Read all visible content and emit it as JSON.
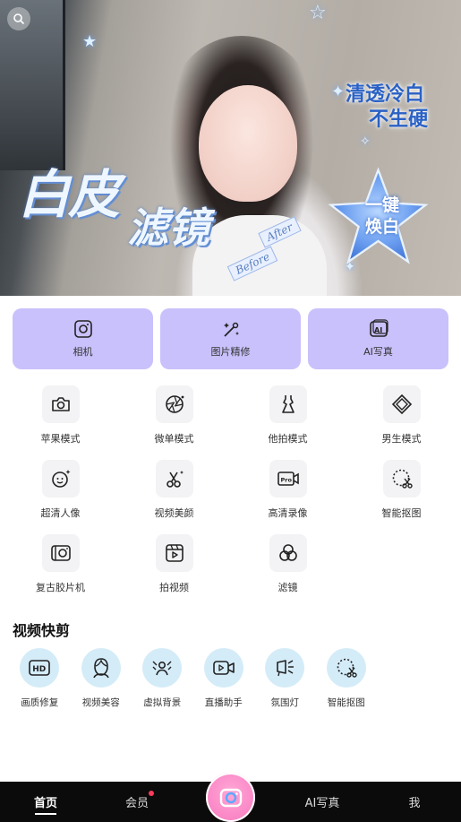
{
  "banner": {
    "title_line1": "白皮",
    "title_line2": "滤镜",
    "slogan_line1": "清透冷白",
    "slogan_line2": "不生硬",
    "badge_line1": "一键",
    "badge_line2": "焕白",
    "tag_before": "Before",
    "tag_after": "After",
    "search_icon": "search-icon"
  },
  "cards": [
    {
      "label": "相机",
      "icon": "camera-icon"
    },
    {
      "label": "图片精修",
      "icon": "magic-wand-icon"
    },
    {
      "label": "AI写真",
      "icon": "ai-portrait-icon"
    }
  ],
  "grid": [
    [
      {
        "label": "苹果模式",
        "icon": "camera-icon"
      },
      {
        "label": "微单模式",
        "icon": "aperture-icon"
      },
      {
        "label": "他拍模式",
        "icon": "dress-icon"
      },
      {
        "label": "男生模式",
        "icon": "diamond-icon"
      }
    ],
    [
      {
        "label": "超清人像",
        "icon": "face-sparkle-icon"
      },
      {
        "label": "视频美颜",
        "icon": "scissors-sparkle-icon"
      },
      {
        "label": "高清录像",
        "icon": "pro-video-icon"
      },
      {
        "label": "智能抠图",
        "icon": "cutout-icon"
      }
    ],
    [
      {
        "label": "复古胶片机",
        "icon": "film-camera-icon"
      },
      {
        "label": "拍视频",
        "icon": "video-clapper-icon"
      },
      {
        "label": "滤镜",
        "icon": "filter-circles-icon"
      }
    ]
  ],
  "video_section": {
    "title": "视频快剪",
    "items": [
      {
        "label": "画质修复",
        "icon": "hd-icon"
      },
      {
        "label": "视频美容",
        "icon": "face-outline-icon"
      },
      {
        "label": "虚拟背景",
        "icon": "virtual-bg-icon"
      },
      {
        "label": "直播助手",
        "icon": "live-camera-icon"
      },
      {
        "label": "氛围灯",
        "icon": "spotlight-icon"
      },
      {
        "label": "智能抠图",
        "icon": "cutout-icon"
      }
    ]
  },
  "nav": {
    "home": "首页",
    "member": "会员",
    "ai": "AI写真",
    "me": "我",
    "center_icon": "camera-icon"
  },
  "colors": {
    "card_bg": "#c9c1fb",
    "tile_bg": "#f3f3f5",
    "circle_bg": "#d4ecf8",
    "nav_bg": "#0b0b0b",
    "fab_pink": "#fb8ac8",
    "badge_red": "#ff3b5c"
  }
}
